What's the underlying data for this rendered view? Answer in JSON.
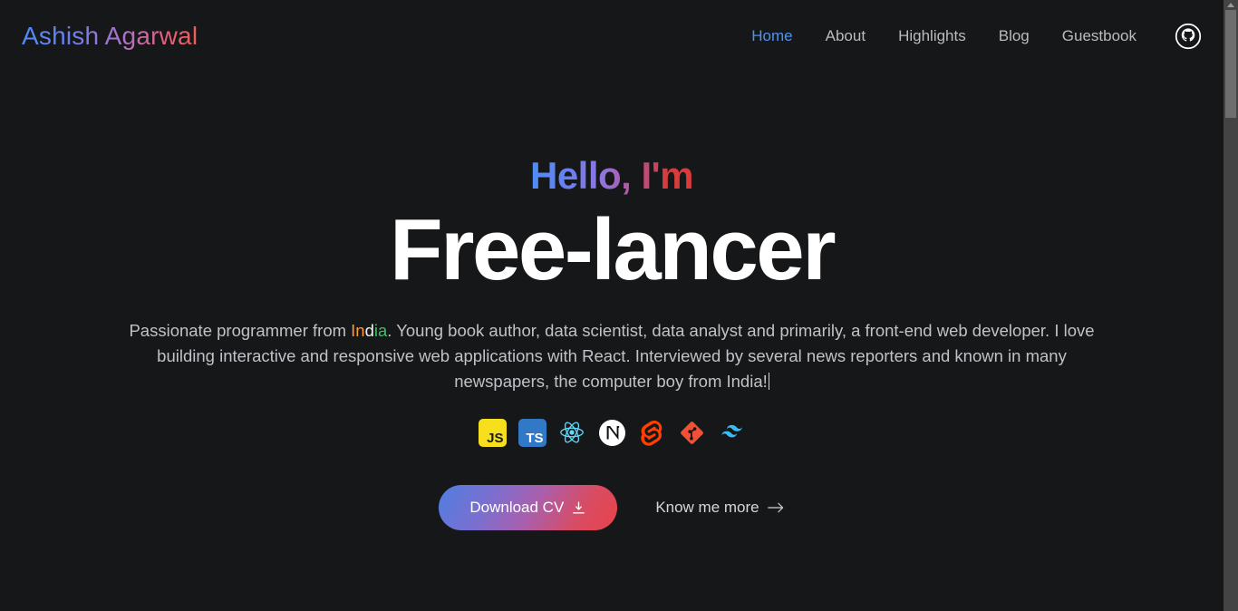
{
  "header": {
    "brand": "Ashish Agarwal",
    "nav": [
      {
        "label": "Home",
        "active": true
      },
      {
        "label": "About",
        "active": false
      },
      {
        "label": "Highlights",
        "active": false
      },
      {
        "label": "Blog",
        "active": false
      },
      {
        "label": "Guestbook",
        "active": false
      }
    ],
    "github_icon": "github-icon"
  },
  "hero": {
    "greeting": "Hello, I'm",
    "headline": "Free-lancer",
    "bio": {
      "part1": "Passionate programmer from ",
      "country_saffron": "In",
      "country_white": "d",
      "country_green": "ia",
      "part2": ". Young book author, data scientist, data analyst and primarily, a front-end web developer. I love building interactive and responsive web applications with React. Interviewed by several news reporters and known in many newspapers, the computer boy from India!"
    },
    "tech": [
      {
        "name": "javascript-icon",
        "label": "JS"
      },
      {
        "name": "typescript-icon",
        "label": "TS"
      },
      {
        "name": "react-icon",
        "label": "React"
      },
      {
        "name": "nextjs-icon",
        "label": "Next.js"
      },
      {
        "name": "svelte-icon",
        "label": "Svelte"
      },
      {
        "name": "git-icon",
        "label": "Git"
      },
      {
        "name": "tailwind-icon",
        "label": "Tailwind CSS"
      }
    ],
    "cta": {
      "download_label": "Download CV",
      "download_icon": "download-icon",
      "know_more_label": "Know me more",
      "know_more_icon": "arrow-right-icon"
    }
  },
  "colors": {
    "background": "#161718",
    "active_nav": "#4d93f0",
    "nav": "#b9bbbe",
    "headline": "#ffffff",
    "bio": "#bfc3c7",
    "saffron": "#ff9933",
    "green": "#3fbf6a",
    "js": "#f7df1e",
    "ts": "#3178c6",
    "react": "#61dafb",
    "svelte": "#ff3e00",
    "git": "#f05033",
    "tailwind": "#38bdf8"
  },
  "scrollbar": {
    "up_arrow_icon": "scroll-up-arrow-icon",
    "thumb": "scroll-thumb"
  }
}
